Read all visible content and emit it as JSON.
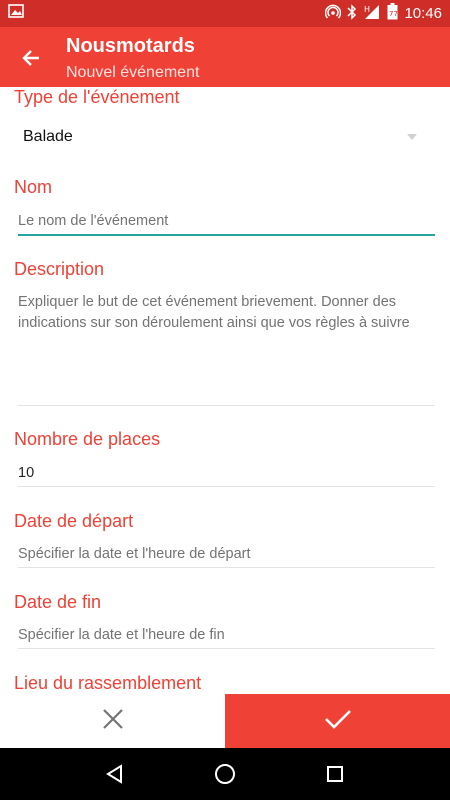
{
  "status_bar": {
    "time": "10:46",
    "icons": [
      "image-notification-icon",
      "hotspot-icon",
      "bluetooth-icon",
      "signal-h-icon",
      "battery-icon"
    ],
    "color": "#cf2d27"
  },
  "app_bar": {
    "title": "Nousmotards",
    "subtitle": "Nouvel événement",
    "color": "#ef4136"
  },
  "form": {
    "event_type": {
      "label": "Type de l'événement",
      "value": "Balade"
    },
    "name": {
      "label": "Nom",
      "placeholder": "Le nom de l'événement"
    },
    "description": {
      "label": "Description",
      "placeholder": "Expliquer le but de cet événement brievement. Donner des indications sur son déroulement ainsi que vos règles à suivre"
    },
    "places": {
      "label": "Nombre de places",
      "value": "10"
    },
    "start_date": {
      "label": "Date de départ",
      "placeholder": "Spécifier la date et l'heure de départ"
    },
    "end_date": {
      "label": "Date de fin",
      "placeholder": "Spécifier la date et l'heure de fin"
    },
    "meeting_place": {
      "label": "Lieu du rassemblement"
    }
  },
  "bottom_bar": {
    "cancel_icon": "close-icon",
    "confirm_icon": "check-icon",
    "accent": "#ef4136"
  },
  "nav_bar": {
    "icons": [
      "back-triangle-icon",
      "home-circle-icon",
      "recents-square-icon"
    ]
  }
}
